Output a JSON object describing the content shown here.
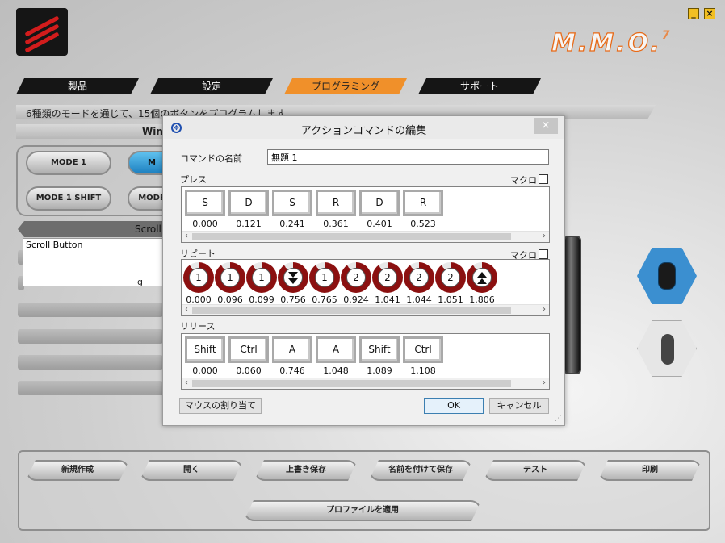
{
  "app": {
    "brand": "M.M.O.",
    "brand_sup": "7",
    "minimize": "_",
    "close": "×"
  },
  "tabs": [
    {
      "label": "製品"
    },
    {
      "label": "設定"
    },
    {
      "label": "プログラミング"
    },
    {
      "label": "サポート"
    }
  ],
  "info_text": "6種類のモードを通じて、15個のボタンをプログラムします。",
  "partial": {
    "win": "Win",
    "mode_b": "M",
    "mode_shift_b": "MODE",
    "scroll_hdr": "Scroll",
    "glimpse": "g"
  },
  "modes": {
    "mode1": "MODE 1",
    "mode1_shift": "MODE 1 SHIFT"
  },
  "scroll_list": {
    "item": "Scroll Button"
  },
  "bottom_buttons": [
    "新規作成",
    "開く",
    "上書き保存",
    "名前を付けて保存",
    "テスト",
    "印刷"
  ],
  "apply_button": "プロファイルを適用",
  "dialog": {
    "title": "アクションコマンドの編集",
    "close": "×",
    "name_label": "コマンドの名前",
    "name_value": "無題 1",
    "macro_label": "マクロ",
    "press": {
      "label": "プレス",
      "keys": [
        {
          "k": "S",
          "t": "0.000"
        },
        {
          "k": "D",
          "t": "0.121"
        },
        {
          "k": "S",
          "t": "0.241"
        },
        {
          "k": "R",
          "t": "0.361"
        },
        {
          "k": "D",
          "t": "0.401"
        },
        {
          "k": "R",
          "t": "0.523"
        }
      ]
    },
    "repeat": {
      "label": "リピート",
      "items": [
        {
          "v": "1",
          "kind": "num",
          "t": "0.000"
        },
        {
          "v": "1",
          "kind": "num",
          "t": "0.096"
        },
        {
          "v": "1",
          "kind": "num",
          "t": "0.099"
        },
        {
          "v": "",
          "kind": "down",
          "t": "0.756"
        },
        {
          "v": "1",
          "kind": "num",
          "t": "0.765"
        },
        {
          "v": "2",
          "kind": "num",
          "t": "0.924"
        },
        {
          "v": "2",
          "kind": "num",
          "t": "1.041"
        },
        {
          "v": "2",
          "kind": "num",
          "t": "1.044"
        },
        {
          "v": "2",
          "kind": "num",
          "t": "1.051"
        },
        {
          "v": "",
          "kind": "up",
          "t": "1.806"
        }
      ]
    },
    "release": {
      "label": "リリース",
      "keys": [
        {
          "k": "Shift",
          "t": "0.000"
        },
        {
          "k": "Ctrl",
          "t": "0.060"
        },
        {
          "k": "A",
          "t": "0.746"
        },
        {
          "k": "A",
          "t": "1.048"
        },
        {
          "k": "Shift",
          "t": "1.089"
        },
        {
          "k": "Ctrl",
          "t": "1.108"
        }
      ]
    },
    "assign_mouse": "マウスの割り当て",
    "ok": "OK",
    "cancel": "キャンセル"
  },
  "colors": {
    "accent": "#f0902a",
    "dark_red": "#8b1010",
    "blue": "#1d80c0"
  }
}
